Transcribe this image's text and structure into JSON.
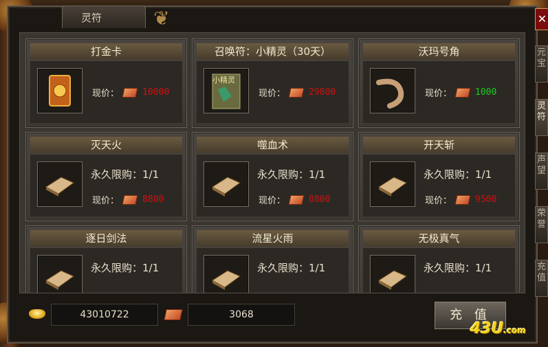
{
  "window": {
    "title": "灵符"
  },
  "side_tabs": [
    "元宝",
    "灵符",
    "声望",
    "荣誉",
    "充值"
  ],
  "items": [
    {
      "name": "打金卡",
      "price_label": "现价：",
      "price": "10000",
      "price_color": "#d01010",
      "icon": "gold-card-icon"
    },
    {
      "name": "召唤符：小精灵（30天）",
      "price_label": "现价：",
      "price": "29800",
      "price_color": "#d01010",
      "icon": "summon-scroll-icon",
      "icon_text": "小精灵"
    },
    {
      "name": "沃玛号角",
      "price_label": "现价：",
      "price": "1000",
      "price_color": "#1ad01a",
      "icon": "horn-icon"
    },
    {
      "name": "灭天火",
      "limit": "永久限购：1/1",
      "price_label": "现价：",
      "price": "8800",
      "price_color": "#d01010",
      "icon": "skill-book-icon"
    },
    {
      "name": "噬血术",
      "limit": "永久限购：1/1",
      "price_label": "现价：",
      "price": "8800",
      "price_color": "#d01010",
      "icon": "skill-book-icon"
    },
    {
      "name": "开天斩",
      "limit": "永久限购：1/1",
      "price_label": "现价：",
      "price": "9500",
      "price_color": "#d01010",
      "icon": "skill-book-icon"
    },
    {
      "name": "逐日剑法",
      "limit": "永久限购：1/1",
      "icon": "skill-book-icon"
    },
    {
      "name": "流星火雨",
      "limit": "永久限购：1/1",
      "icon": "skill-book-icon"
    },
    {
      "name": "无极真气",
      "limit": "永久限购：1/1",
      "icon": "skill-book-icon"
    }
  ],
  "bottom": {
    "gold": "43010722",
    "tickets": "3068",
    "recharge_label": "充 值"
  },
  "watermark": "43U.com"
}
